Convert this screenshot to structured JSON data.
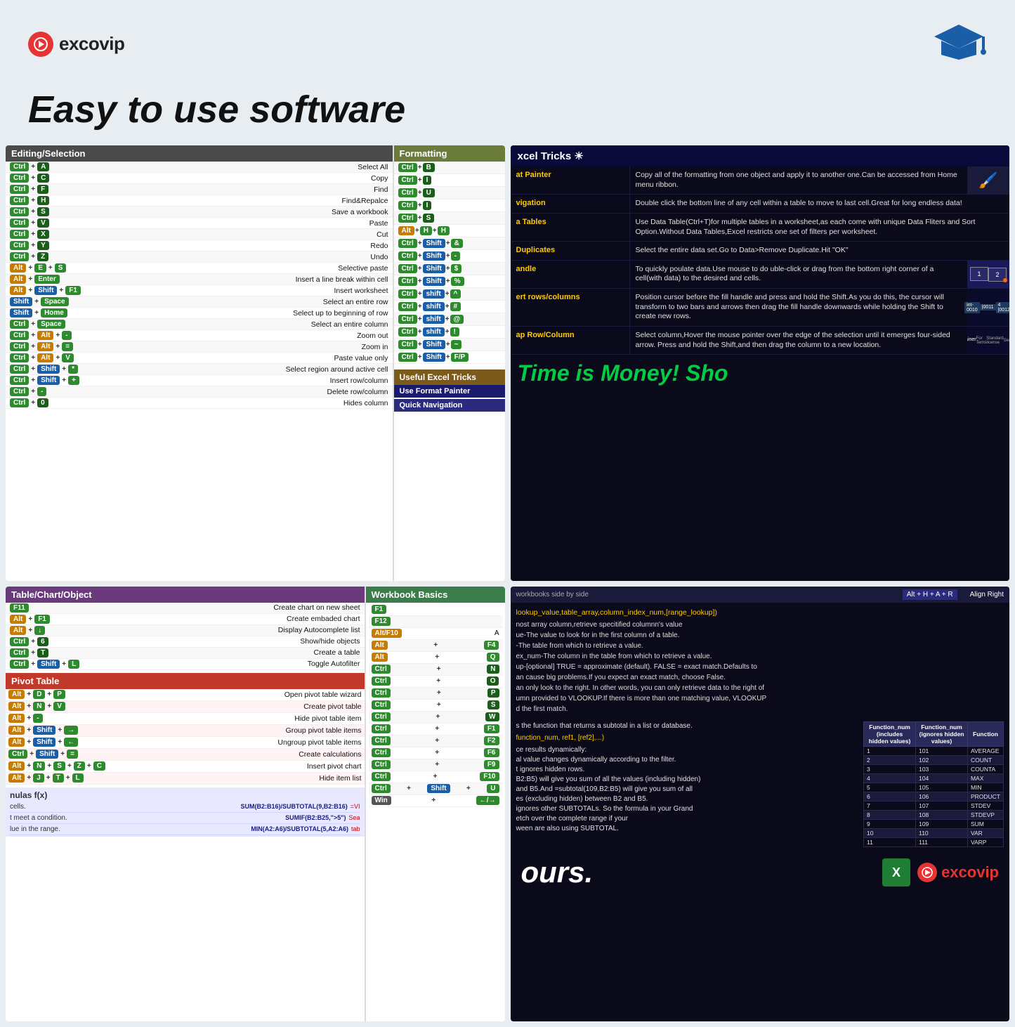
{
  "header": {
    "logo_text": "excovip",
    "tagline": "Easy to use software",
    "grad_cap": "🎓"
  },
  "panels": {
    "top_left": {
      "editing_header": "Editing/Selection",
      "formatting_header": "Formatting",
      "shortcuts_editing": [
        {
          "keys": [
            "Ctrl",
            "+",
            "A"
          ],
          "action": "Select All"
        },
        {
          "keys": [
            "Ctrl",
            "+",
            "C"
          ],
          "action": "Copy"
        },
        {
          "keys": [
            "Ctrl",
            "+",
            "F"
          ],
          "action": "Find"
        },
        {
          "keys": [
            "Ctrl",
            "+",
            "H"
          ],
          "action": "Find&Repalce"
        },
        {
          "keys": [
            "Ctrl",
            "+",
            "S"
          ],
          "action": "Save a workbook"
        },
        {
          "keys": [
            "Ctrl",
            "+",
            "V"
          ],
          "action": "Paste"
        },
        {
          "keys": [
            "Ctrl",
            "+",
            "X"
          ],
          "action": "Cut"
        },
        {
          "keys": [
            "Ctrl",
            "+",
            "Y"
          ],
          "action": "Redo"
        },
        {
          "keys": [
            "Ctrl",
            "+",
            "Z"
          ],
          "action": "Undo"
        },
        {
          "keys": [
            "Alt",
            "+",
            "E",
            "+",
            "S"
          ],
          "action": "Selective paste"
        },
        {
          "keys": [
            "Alt",
            "+",
            "Enter"
          ],
          "action": "Insert a line break within cell"
        },
        {
          "keys": [
            "Alt",
            "+",
            "Shift",
            "+",
            "F1"
          ],
          "action": "Insert worksheet"
        },
        {
          "keys": [
            "Shift",
            "+",
            "Space"
          ],
          "action": "Select an entire row"
        },
        {
          "keys": [
            "Shift",
            "+",
            "Home"
          ],
          "action": "Select up to beginning of row"
        },
        {
          "keys": [
            "Ctrl",
            "+",
            "Space"
          ],
          "action": "Select an entire column"
        },
        {
          "keys": [
            "Ctrl",
            "+",
            "Alt",
            "+",
            "-"
          ],
          "action": "Zoom out"
        },
        {
          "keys": [
            "Ctrl",
            "+",
            "Alt",
            "+",
            "="
          ],
          "action": "Zoom in"
        },
        {
          "keys": [
            "Ctrl",
            "+",
            "Alt",
            "+",
            "V"
          ],
          "action": "Paste value only"
        },
        {
          "keys": [
            "Ctrl",
            "+",
            "Shift",
            "+",
            "*"
          ],
          "action": "Select region around active cell"
        },
        {
          "keys": [
            "Ctrl",
            "+",
            "Shift",
            "+",
            "+"
          ],
          "action": "Insert row/column"
        },
        {
          "keys": [
            "Ctrl",
            "+",
            "-"
          ],
          "action": "Delete row/column"
        },
        {
          "keys": [
            "Ctrl",
            "+",
            "0"
          ],
          "action": "Hides column"
        }
      ],
      "shortcuts_formatting": [
        {
          "keys": [
            "Ctrl",
            "+",
            "B"
          ]
        },
        {
          "keys": [
            "Ctrl",
            "+",
            "I"
          ]
        },
        {
          "keys": [
            "Ctrl",
            "+",
            "U"
          ]
        },
        {
          "keys": [
            "Ctrl",
            "+",
            "I"
          ]
        },
        {
          "keys": [
            "Ctrl",
            "+",
            "S"
          ]
        },
        {
          "keys": [
            "Alt",
            "+",
            "H",
            "+",
            "H"
          ]
        },
        {
          "keys": [
            "Ctrl",
            "+",
            "Shift",
            "+",
            "&"
          ]
        },
        {
          "keys": [
            "Ctrl",
            "+",
            "Shift",
            "+",
            "-"
          ]
        },
        {
          "keys": [
            "Ctrl",
            "+",
            "Shift",
            "+",
            "$"
          ]
        },
        {
          "keys": [
            "Ctrl",
            "+",
            "Shift",
            "+",
            "%"
          ]
        },
        {
          "keys": [
            "Ctrl",
            "+",
            "shift",
            "+",
            "^"
          ]
        },
        {
          "keys": [
            "Ctrl",
            "+",
            "shift",
            "+",
            "#"
          ]
        },
        {
          "keys": [
            "Ctrl",
            "+",
            "shift",
            "+",
            "@"
          ]
        },
        {
          "keys": [
            "Ctrl",
            "+",
            "shift",
            "+",
            "!"
          ]
        },
        {
          "keys": [
            "Ctrl",
            "+",
            "Shift",
            "+",
            "~"
          ]
        },
        {
          "keys": [
            "Ctrl",
            "+",
            "Shift",
            "+",
            "F/P"
          ]
        }
      ],
      "useful_label": "Useful Excel Tricks",
      "use_format_painter": "Use Format Painter",
      "quick_navigation": "Quick Navigation"
    },
    "top_right": {
      "header": "xcel Tricks",
      "tricks": [
        {
          "name": "at Painter",
          "desc": "Copy all of the formatting from one object and apply it to another one.Can be accessed from Home menu ribbon."
        },
        {
          "name": "vigation",
          "desc": "Double click the bottom line of any cell within a table to move to last cell.Great for long endless data!"
        },
        {
          "name": "a Tables",
          "desc": "Use Data Table(Ctrl+T)for multiple tables in a worksheet,as each come with unique Data Fliters and Sort Option.Without Data Tables,Excel restricts one set of filters per worksheet."
        },
        {
          "name": "Duplicates",
          "desc": "Select the entire data set.Go to Data>Remove Duplicate.Hit \"OK\""
        },
        {
          "name": "andle",
          "desc": "To quickly poulate data.Use mouse to do uble-click or drag from the bottom right corner of a cell(with data) to the desired and cells."
        },
        {
          "name": "ert rows/columns",
          "desc": "Position cursor before the fill handle and press and hold the Shift.As you do this, the cursor will transform to two bars and arrows then drag the fill handle downwards while holding the Shift to create new rows."
        },
        {
          "name": "ap Row/Column",
          "desc": "Select column,Hover the mouse pointer over the edge of the selection until it emerges four-sided arrow. Press and hold the Shift,and then drag the column to a new location."
        }
      ],
      "time_money": "Time is Money!  Sho"
    },
    "bottom_left": {
      "table_header": "Table/Chart/Object",
      "workbook_header": "Workbook Basics",
      "shortcuts_table": [
        {
          "keys": [
            "F11"
          ],
          "action": "Create chart on new sheet"
        },
        {
          "keys": [
            "Alt",
            "+",
            "F1"
          ],
          "action": "Create embaded chart"
        },
        {
          "keys": [
            "Alt",
            "+",
            "↓"
          ],
          "action": "Display Autocomplete list"
        },
        {
          "keys": [
            "Ctrl",
            "+",
            "6"
          ],
          "action": "Show/hide objects"
        },
        {
          "keys": [
            "Ctrl",
            "+",
            "T"
          ],
          "action": "Create a table"
        },
        {
          "keys": [
            "Ctrl",
            "+",
            "Shift",
            "+",
            "L"
          ],
          "action": "Toggle Autofilter"
        }
      ],
      "pivot_header": "Pivot Table",
      "shortcuts_pivot": [
        {
          "keys": [
            "Alt",
            "+",
            "D",
            "+",
            "P"
          ],
          "action": "Open pivot table wizard"
        },
        {
          "keys": [
            "Alt",
            "+",
            "N",
            "+",
            "V"
          ],
          "action": "Create pivot table"
        },
        {
          "keys": [
            "Alt",
            "+",
            "-"
          ],
          "action": "Hide pivot table item"
        },
        {
          "keys": [
            "Alt",
            "+",
            "Shift",
            "+",
            "→"
          ],
          "action": "Group pivot table items"
        },
        {
          "keys": [
            "Alt",
            "+",
            "Shift",
            "+",
            "←"
          ],
          "action": "Ungroup pivot table items"
        },
        {
          "keys": [
            "Ctrl",
            "+",
            "Shift",
            "+",
            "="
          ],
          "action": "Create calculations"
        },
        {
          "keys": [
            "Alt",
            "+",
            "N",
            "+",
            "S",
            "+",
            "Z",
            "+",
            "C"
          ],
          "action": "Insert pivot chart"
        },
        {
          "keys": [
            "Alt",
            "+",
            "J",
            "+",
            "T",
            "+",
            "L"
          ],
          "action": "Hide item list"
        }
      ],
      "formulas_header": "nulas f(x)",
      "formulas": [
        {
          "desc": "cells.",
          "formula": "SUM(B2:B16)/SUBTOTAL(9,B2:B16)",
          "extra": "=VI"
        },
        {
          "desc": "t meet a condition.",
          "formula": "SUMIF(B2:B25,\">5\")",
          "extra": "Sea"
        },
        {
          "desc": "lue in the range.",
          "formula": "MIN(A2:A6)/SUBTOTAL(5,A2:A6)",
          "extra": "tab"
        }
      ],
      "workbook_shortcuts": [
        {
          "keys": [
            "F1"
          ],
          "action": ""
        },
        {
          "keys": [
            "F12"
          ],
          "action": ""
        },
        {
          "keys": [
            "Alt/F10"
          ],
          "action": "A"
        },
        {
          "keys": [
            "Alt",
            "+",
            "F4"
          ],
          "action": ""
        },
        {
          "keys": [
            "Alt",
            "+",
            "Q"
          ],
          "action": ""
        },
        {
          "keys": [
            "Ctrl",
            "+",
            "N"
          ],
          "action": ""
        },
        {
          "keys": [
            "Ctrl",
            "+",
            "O"
          ],
          "action": ""
        },
        {
          "keys": [
            "Ctrl",
            "+",
            "P"
          ],
          "action": ""
        },
        {
          "keys": [
            "Ctrl",
            "+",
            "S"
          ],
          "action": ""
        },
        {
          "keys": [
            "Ctrl",
            "+",
            "W"
          ],
          "action": ""
        },
        {
          "keys": [
            "Ctrl",
            "+",
            "F1"
          ],
          "action": ""
        },
        {
          "keys": [
            "Ctrl",
            "+",
            "F2"
          ],
          "action": ""
        },
        {
          "keys": [
            "Ctrl",
            "+",
            "F6"
          ],
          "action": ""
        },
        {
          "keys": [
            "Ctrl",
            "+",
            "F9"
          ],
          "action": ""
        },
        {
          "keys": [
            "Ctrl",
            "+",
            "F10"
          ],
          "action": ""
        },
        {
          "keys": [
            "Ctrl",
            "+",
            "Shift",
            "+",
            "U"
          ],
          "action": ""
        },
        {
          "keys": [
            "Win",
            "+",
            "←/→"
          ],
          "action": ""
        }
      ]
    },
    "bottom_right": {
      "workbooks_bar": "workbooks side by side",
      "align_right": "Align Right",
      "vlookup_syntax": "lookup_value,table_array,column_index_num,[range_lookup])",
      "vlookup_lines": [
        "nost array column,retrieve specitified columnn's value",
        "ue-The value to look for in the first column of a table.",
        "-The table from which to retrieve a value.",
        "ex_num-The column in the table from which to retrieve a value.",
        "up-[optional] TRUE = approximate (default). FALSE = exact match.Defaults to",
        "an cause big problems.If you expect an exact match, choose False.",
        "an only look to the right. In other words, you can only retrieve data to the right of",
        "umn provided to VLOOKUP.If there is more than one matching value, VLOOKUP",
        "d the first match."
      ],
      "subtotal_intro": "s the function that returns a subtotal in a list or database.",
      "subtotal_syntax": "function_num, ref1, [ref2],...)",
      "subtotal_points": [
        "ce results dynamically:",
        "al value changes dynamically according to the filter.",
        "t ignores hidden rows.",
        "B2:B5) will give you sum of all the values (including hidden)",
        "and B5.And =subtotal(109,B2:B5) will give you sum of all",
        "es (excluding hidden) between B2 and B5.",
        "ignores other SUBTOTALs. So the formula in your Grand",
        "etch over the complete range if your",
        "ween are also using SUBTOTAL."
      ],
      "table_headers": [
        "Function_num (includes hidden values)",
        "Function_num (ignores hidden values)",
        "Function"
      ],
      "table_data": [
        [
          "1",
          "101",
          "AVERAGE"
        ],
        [
          "2",
          "102",
          "COUNT"
        ],
        [
          "3",
          "103",
          "COUNTA"
        ],
        [
          "4",
          "104",
          "MAX"
        ],
        [
          "5",
          "105",
          "MIN"
        ],
        [
          "6",
          "106",
          "PRODUCT"
        ],
        [
          "7",
          "107",
          "STDEV"
        ],
        [
          "8",
          "108",
          "STDEVP"
        ],
        [
          "9",
          "109",
          "SUM"
        ],
        [
          "10",
          "110",
          "VAR"
        ],
        [
          "11",
          "111",
          "VARP"
        ]
      ],
      "ours_text": "ours.",
      "excel_icon": "X",
      "excovip_label": "excovip"
    }
  }
}
